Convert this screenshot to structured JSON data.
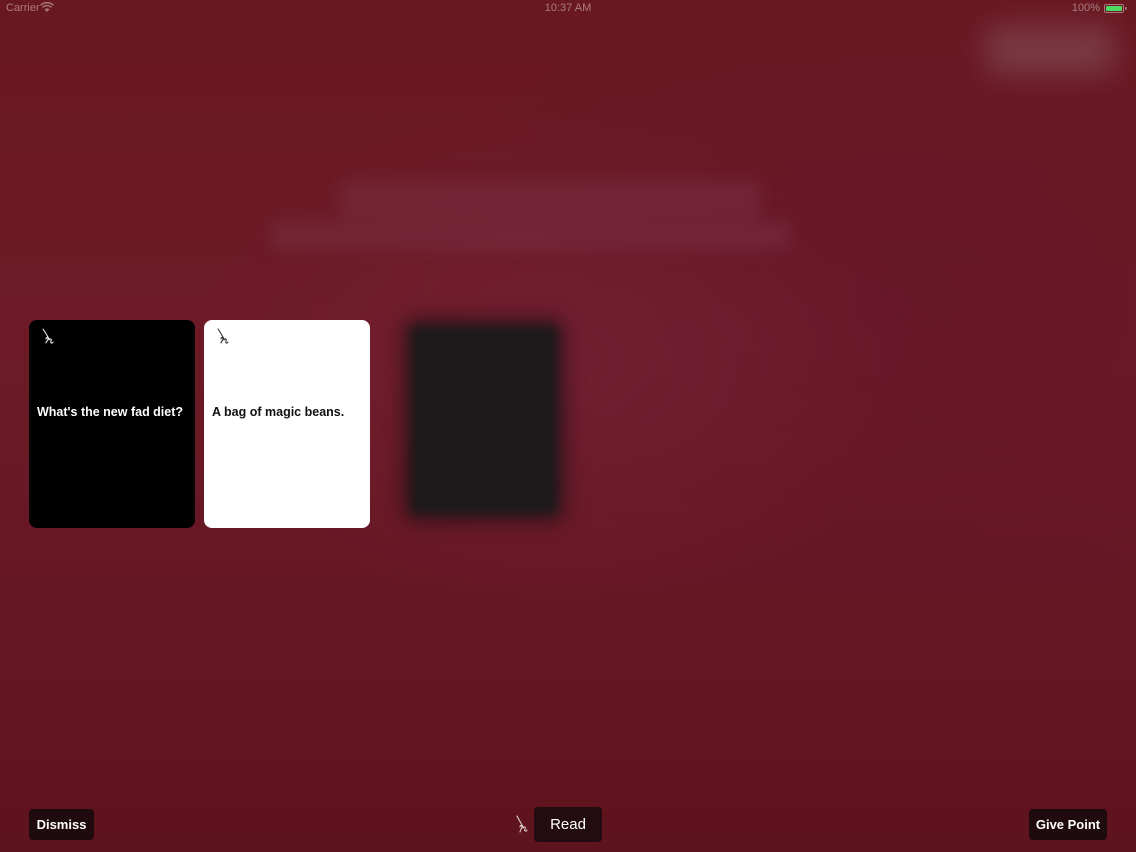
{
  "status_bar": {
    "carrier": "Carrier",
    "time": "10:37 AM",
    "battery": "100%",
    "wifi_icon": "wifi-icon",
    "battery_icon": "battery-icon",
    "battery_color": "#4cd964"
  },
  "cards": {
    "question": {
      "text": "What's the new fad diet?",
      "icon": "card-logo-icon",
      "background": "#000000"
    },
    "answer": {
      "text": "A bag of magic beans.",
      "icon": "card-logo-icon",
      "background": "#ffffff"
    }
  },
  "toolbar": {
    "dismiss_label": "Dismiss",
    "read_label": "Read",
    "read_icon": "card-logo-icon",
    "give_point_label": "Give Point"
  },
  "colors": {
    "background": "#6a1820",
    "button_background": "#1f0b0d"
  }
}
